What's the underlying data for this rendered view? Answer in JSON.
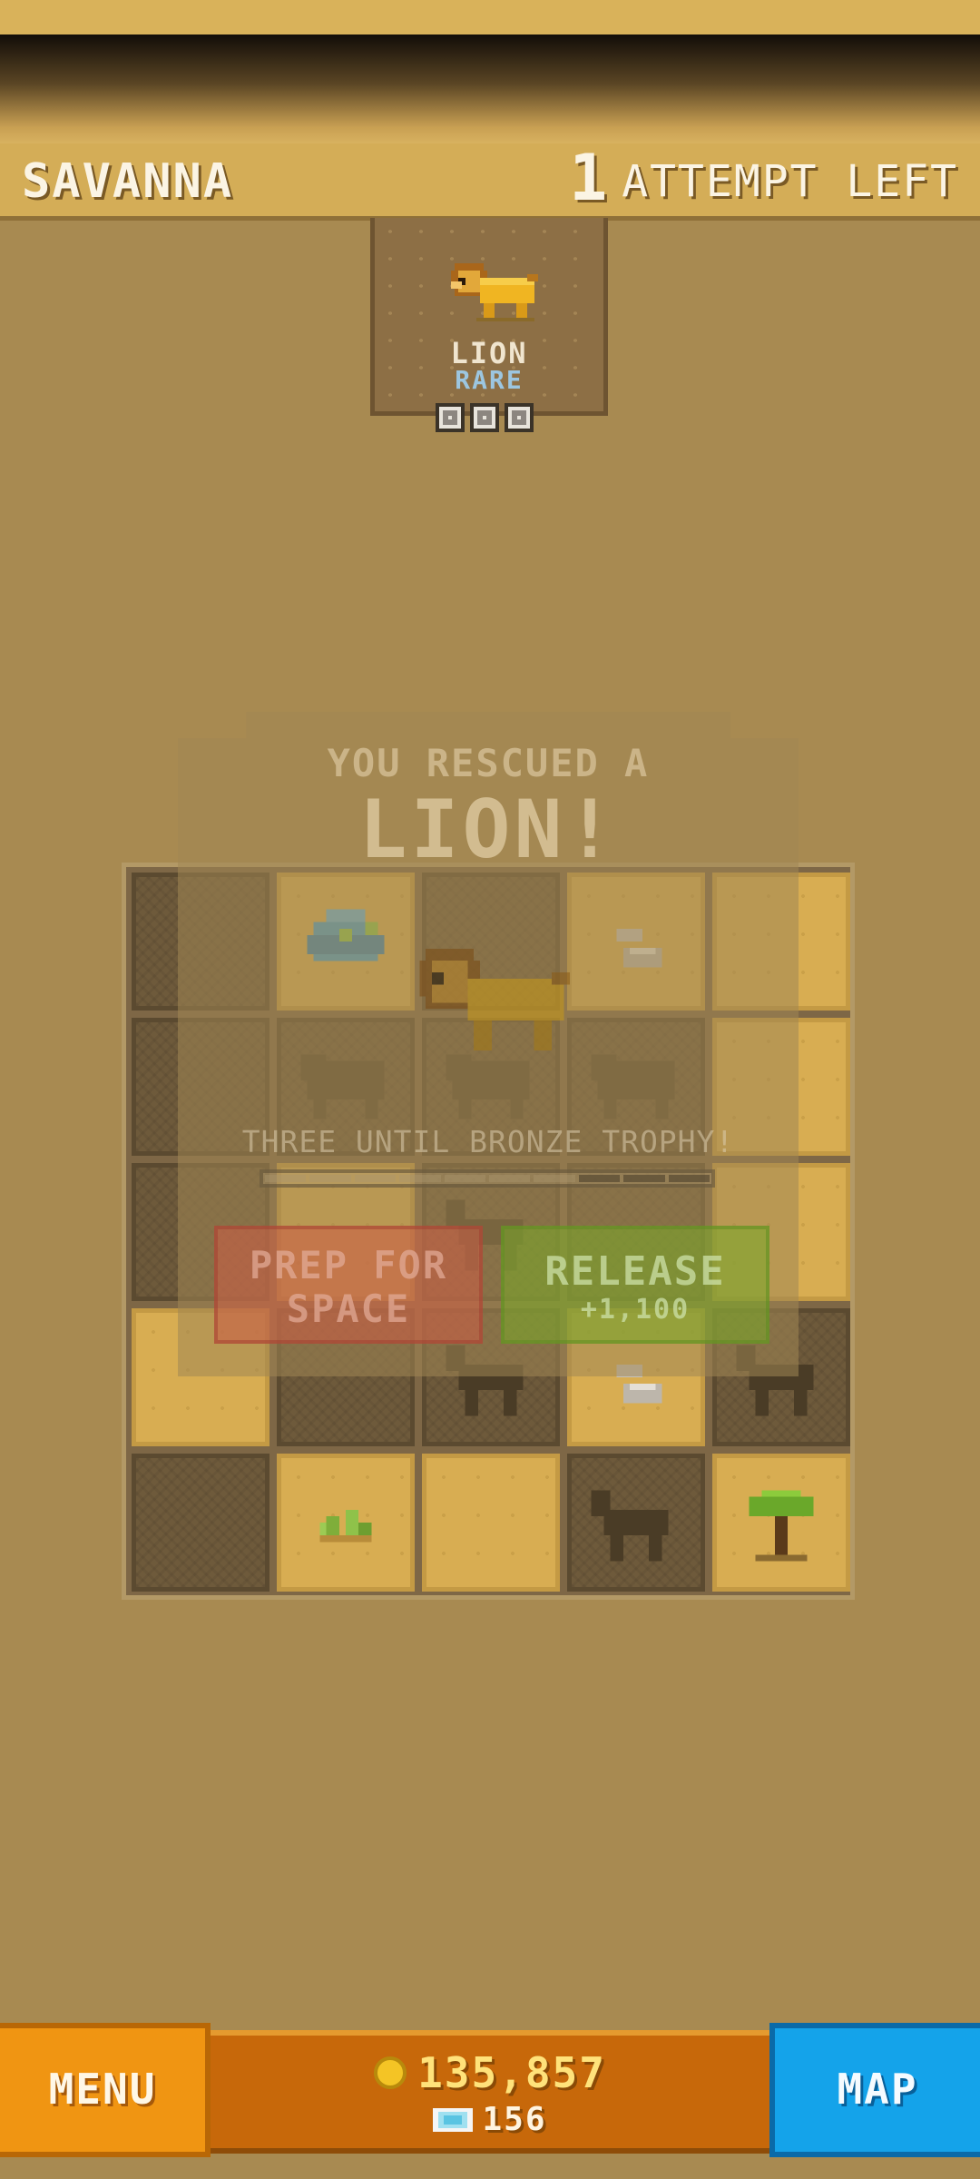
{
  "header": {
    "biome": "SAVANNA",
    "attempts_number": "1",
    "attempts_label": "ATTEMPT LEFT"
  },
  "animal_card": {
    "name": "LION",
    "rarity": "RARE",
    "icon": "lion-icon",
    "slots": 3
  },
  "dialog": {
    "subtitle": "YOU RESCUED A",
    "title": "LION!",
    "trophy_text": "THREE UNTIL BRONZE TROPHY!",
    "trophy_progress": {
      "filled": 3,
      "total": 10
    },
    "prep_label": "PREP FOR SPACE",
    "release_label": "RELEASE",
    "release_reward": "+1,100"
  },
  "board": {
    "rows": 5,
    "cols": 5,
    "tiles": [
      [
        "covered",
        "open:bush-blue",
        "covered",
        "open:rocks",
        "open"
      ],
      [
        "covered",
        "covered:buffalo",
        "covered:buffalo",
        "covered:buffalo",
        "open"
      ],
      [
        "covered",
        "open",
        "covered:zebra",
        "covered",
        "open"
      ],
      [
        "open",
        "covered",
        "covered:zebra",
        "open:rocks",
        "covered:zebra"
      ],
      [
        "covered",
        "open:shrub",
        "open",
        "covered:zebra",
        "open:acacia-tree"
      ]
    ]
  },
  "footer": {
    "menu_label": "MENU",
    "coins": "135,857",
    "gems": "156",
    "map_label": "MAP"
  },
  "colors": {
    "background": "#a88a51",
    "menu": "#f09512",
    "map": "#14a3ea",
    "currency_panel": "#c7680a",
    "coin_text": "#ffe27a",
    "rarity_text": "#9cc6e0"
  }
}
